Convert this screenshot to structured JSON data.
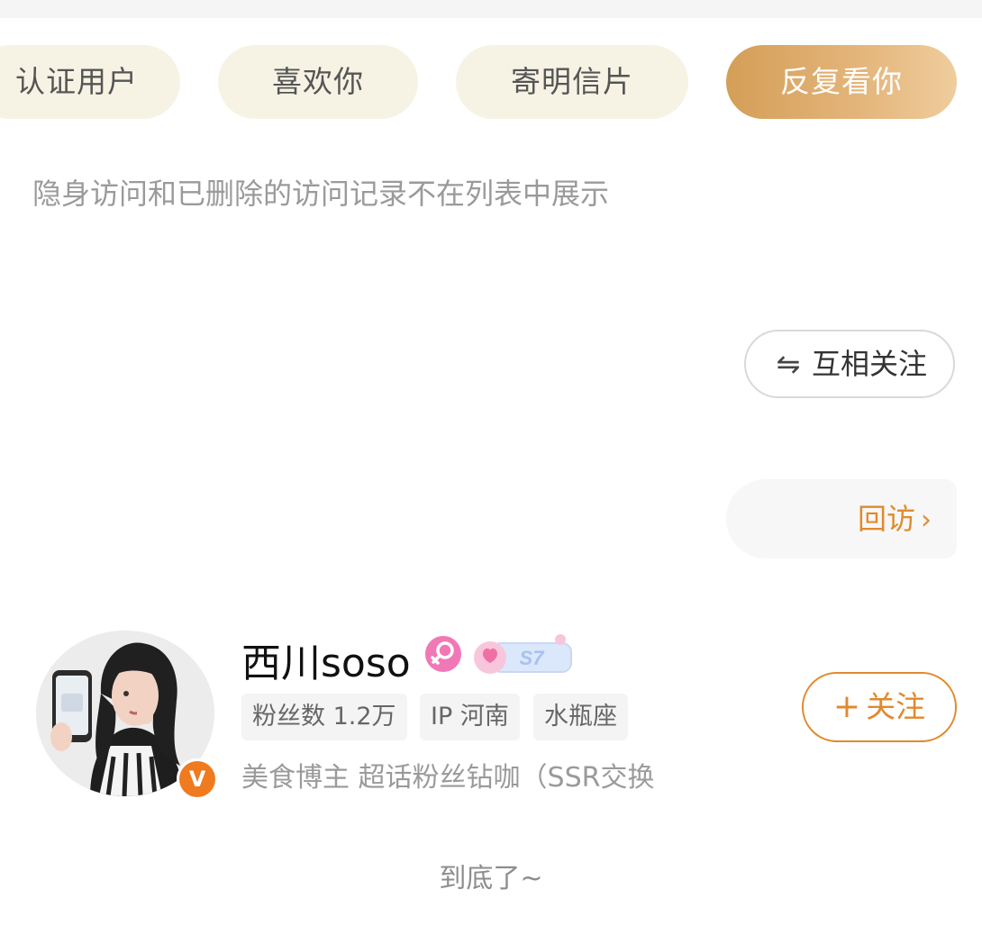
{
  "filters": [
    {
      "label": "认证用户",
      "active": false
    },
    {
      "label": "喜欢你",
      "active": false
    },
    {
      "label": "寄明信片",
      "active": false
    },
    {
      "label": "反复看你",
      "active": true
    }
  ],
  "hint": "隐身访问和已删除的访问记录不在列表中展示",
  "mutual_button": {
    "label": "互相关注",
    "icon": "swap-icon"
  },
  "return_visit": {
    "label": "回访",
    "icon": "chevron-right-icon"
  },
  "user": {
    "name": "西川soso",
    "gender_icon": "female-icon",
    "level_badge": "S7",
    "verified_badge": "V",
    "tags": [
      "粉丝数 1.2万",
      "IP 河南",
      "水瓶座"
    ],
    "bio": "美食博主 超话粉丝钻咖（SSR交换"
  },
  "follow_button": {
    "label": "关注",
    "icon": "plus-icon"
  },
  "end_text": "到底了~",
  "colors": {
    "accent": "#e08a2e",
    "active_pill_start": "#d49e57",
    "active_pill_end": "#efcd9d",
    "pill_bg": "#f7f3e4",
    "hint_text": "#9a9a9a",
    "gender_pink": "#f178b6",
    "verified_orange": "#f07a1e"
  }
}
